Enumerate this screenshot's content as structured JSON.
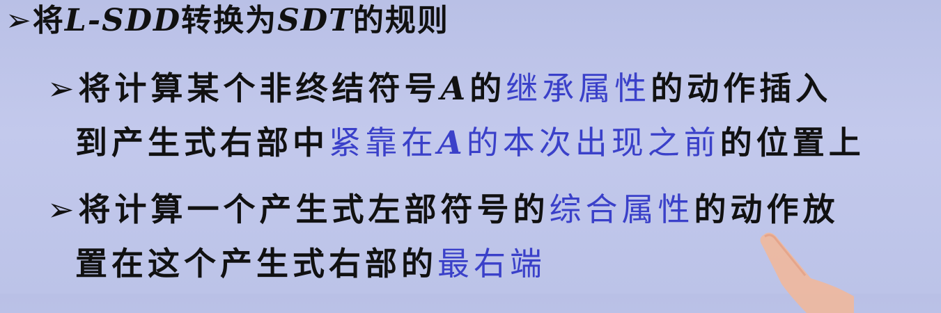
{
  "bullet_glyph": "➢",
  "main": {
    "pre": "将",
    "term1": "L-SDD",
    "mid": "转换为",
    "term2": "SDT",
    "post": "的规则"
  },
  "rule1": {
    "line1_pre": "将计算某个非终结符号",
    "symbol": "A",
    "line1_mid": "的",
    "line1_highlight": "继承属性",
    "line1_post": "的动作插入",
    "line2_pre": "到产生式右部中",
    "line2_hl_a": "紧靠在",
    "line2_hl_symbol": "A",
    "line2_hl_b": "的本次出现之前",
    "line2_post": "的位置上"
  },
  "rule2": {
    "line1_pre": "将计算一个产生式左部符号的",
    "line1_highlight": "综合属性",
    "line1_post": "的动作放",
    "line2_pre": "置在这个产生式右部的",
    "line2_highlight": "最右端"
  },
  "colors": {
    "background": "#c0c6ea",
    "text": "#111111",
    "highlight": "#3a40c9"
  }
}
